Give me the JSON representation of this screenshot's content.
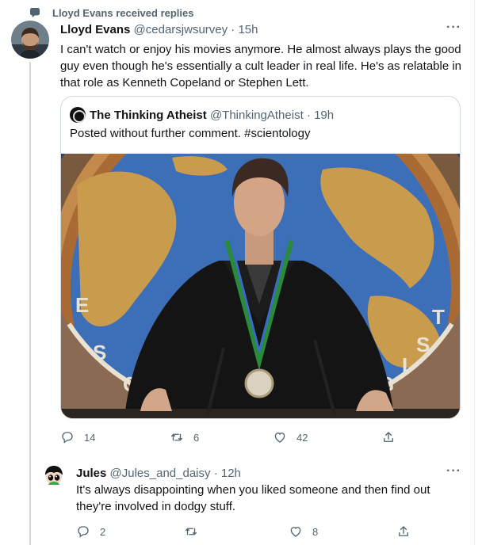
{
  "context": {
    "icon": "reply-context-icon",
    "text": "Lloyd Evans received replies"
  },
  "tweet1": {
    "name": "Lloyd Evans",
    "handle": "@cedarsjwsurvey",
    "separator": "·",
    "time": "15h",
    "more": "···",
    "text": "I can't watch or enjoy his movies anymore. He almost always plays the good guy even though he's essentially a cult leader in real life. He's as relatable in that role as Kenneth Copeland or Stephen Lett.",
    "quote": {
      "name": "The Thinking Atheist",
      "handle": "@ThinkingAtheist",
      "separator": "·",
      "time": "19h",
      "text": "Posted without further comment. #scientology"
    },
    "actions": {
      "replies": "14",
      "retweets": "6",
      "likes": "42"
    }
  },
  "tweet2": {
    "name": "Jules",
    "handle": "@Jules_and_daisy",
    "separator": "·",
    "time": "12h",
    "more": "···",
    "text": "It's always disappointing when you liked someone and then find out they're involved in dodgy stuff.",
    "actions": {
      "replies": "2",
      "retweets": "",
      "likes": "8"
    }
  },
  "colors": {
    "secondary_text": "#536471",
    "divider": "#cfd9de",
    "primary_text": "#0f1419"
  }
}
